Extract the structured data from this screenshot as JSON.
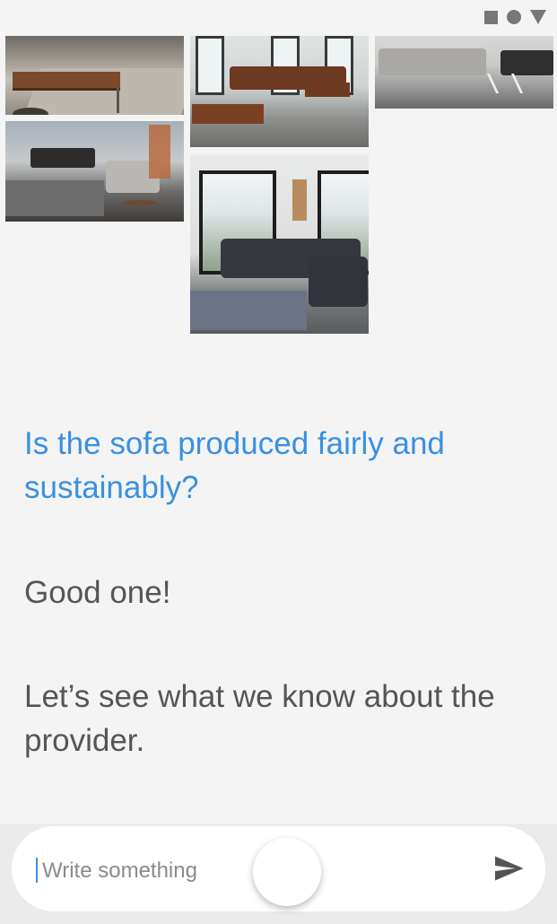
{
  "conversation": {
    "question": "Is the sofa produced fairly and sustainably?",
    "replies": [
      "Good one!",
      "Let’s see what we know about the provider."
    ]
  },
  "composer": {
    "placeholder": "Write something"
  },
  "icons": {
    "status": [
      "square-icon",
      "circle-icon",
      "triangle-icon"
    ],
    "send": "send-icon"
  },
  "colors": {
    "question": "#3a90e0",
    "reply": "#555555",
    "background": "#f4f4f4"
  }
}
